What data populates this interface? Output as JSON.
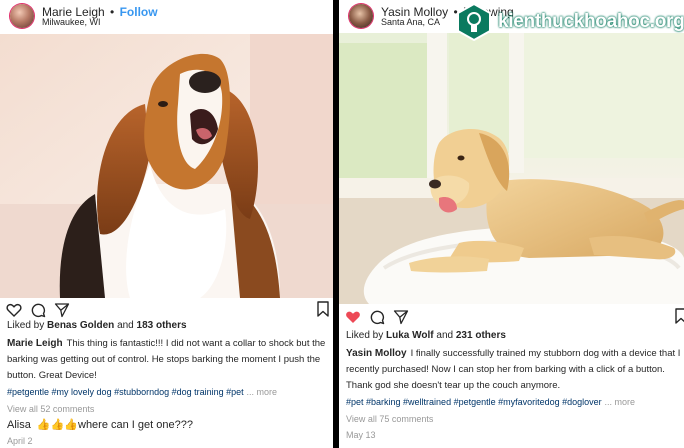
{
  "left_post": {
    "username": "Marie Leigh",
    "separator": "•",
    "follow_label": "Follow",
    "location": "Milwaukee, WI",
    "likes": {
      "prefix": "Liked by",
      "liker": "Benas Golden",
      "joiner": "and",
      "count": "183 others"
    },
    "caption": {
      "user": "Marie Leigh",
      "text": "This thing is fantastic!!! I did not want a collar to shock but the barking was getting out of control. He stops barking the moment I push the button. Great Device!",
      "tags": "#petgentle #my lovely dog #stubborndog #dog training #pet",
      "more": "... more"
    },
    "view_all": "View all 52 comments",
    "comment": {
      "user": "Alisa",
      "emoji": "👍👍👍",
      "text": "where can I get one???"
    },
    "date": "April 2"
  },
  "right_post": {
    "username": "Yasin Molloy",
    "separator": "•",
    "follow_label": "Following",
    "location": "Santa Ana, CA",
    "likes": {
      "prefix": "Liked by",
      "liker": "Luka Wolf",
      "joiner": "and",
      "count": "231 others"
    },
    "caption": {
      "user": "Yasin Molloy",
      "text": "I finally successfully trained my stubborn dog with a device that I recently purchased! Now I can stop her from barking with a click of a button. Thank god she doesn't tear up the couch anymore.",
      "tags": "#pet #barking #welltrained #petgentle #myfavoritedog #doglover",
      "more": "... more"
    },
    "view_all": "View all 75 comments",
    "date": "May 13"
  },
  "watermark": {
    "text": "kienthuckhoahoc.org"
  },
  "colors": {
    "follow": "#3897f0",
    "like_active": "#ed4956",
    "tag": "#003569",
    "muted": "#999999",
    "watermark_green": "#0a7a5f"
  }
}
